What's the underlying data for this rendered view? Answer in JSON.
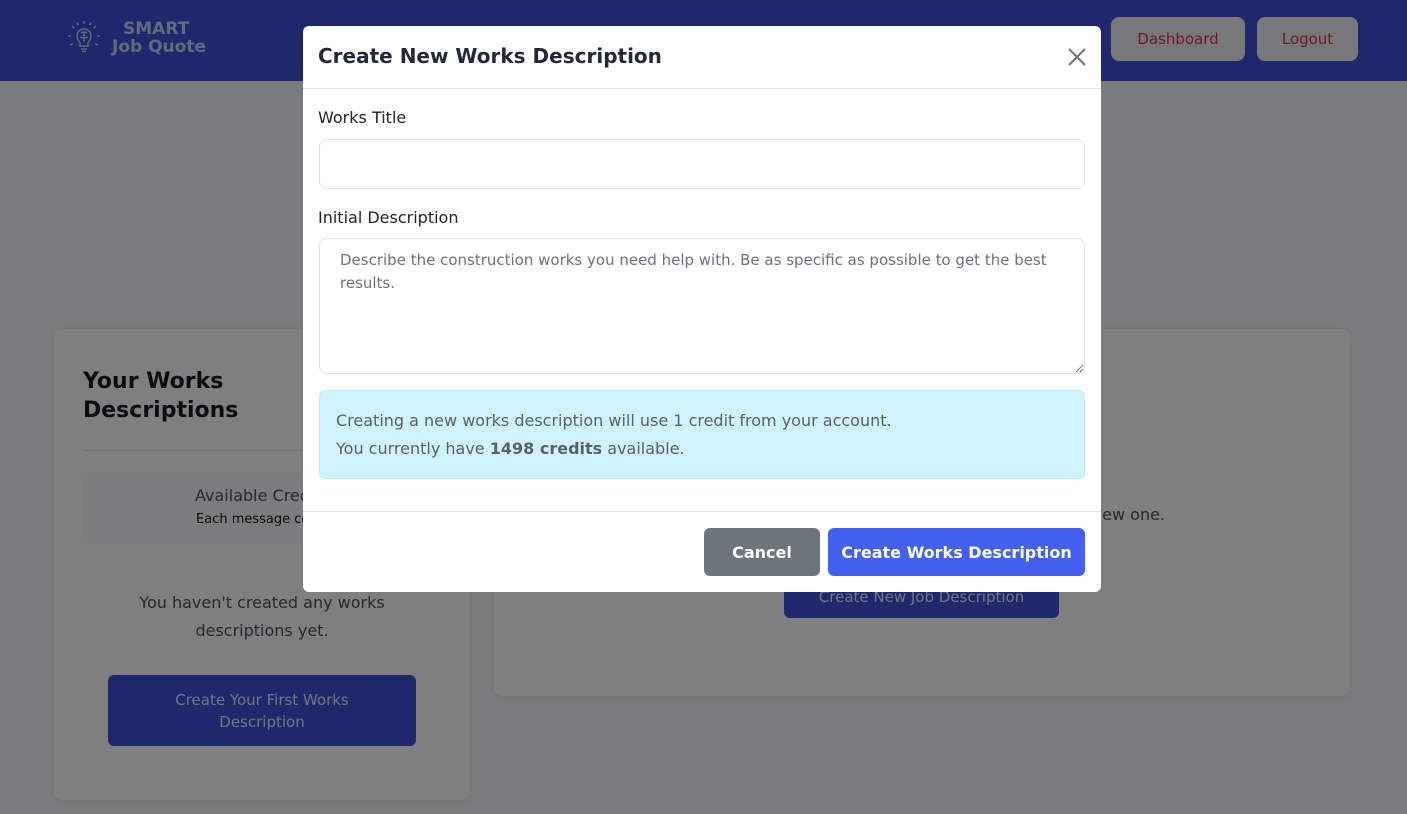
{
  "navbar": {
    "logo_line1": "SMART",
    "logo_line2": "Job Quote",
    "dashboard_label": "Dashboard",
    "logout_label": "Logout"
  },
  "left_card": {
    "title": "Your Works Descriptions",
    "credits_label": "Available Credits",
    "credits_sub": "Each message costs",
    "empty_text": "You haven't created any works descriptions yet.",
    "first_button_label": "Create Your First Works Description"
  },
  "right_card": {
    "text_fragment": "new one.",
    "button_label": "Create New Job Description"
  },
  "modal": {
    "title": "Create New Works Description",
    "works_title_label": "Works Title",
    "works_title_value": "",
    "description_label": "Initial Description",
    "description_placeholder": "Describe the construction works you need help with. Be as specific as possible to get the best results.",
    "alert_line1": "Creating a new works description will use 1 credit from your account.",
    "alert_line2_prefix": "You currently have ",
    "alert_credits": "1498 credits",
    "alert_line2_suffix": " available.",
    "cancel_label": "Cancel",
    "create_label": "Create Works Description"
  },
  "colors": {
    "navbar": "#3f51d8",
    "primary_button": "#4361ee",
    "cancel_button": "#6c757d",
    "alert_bg": "#cff4fc",
    "nav_button_text": "#e0344e"
  }
}
